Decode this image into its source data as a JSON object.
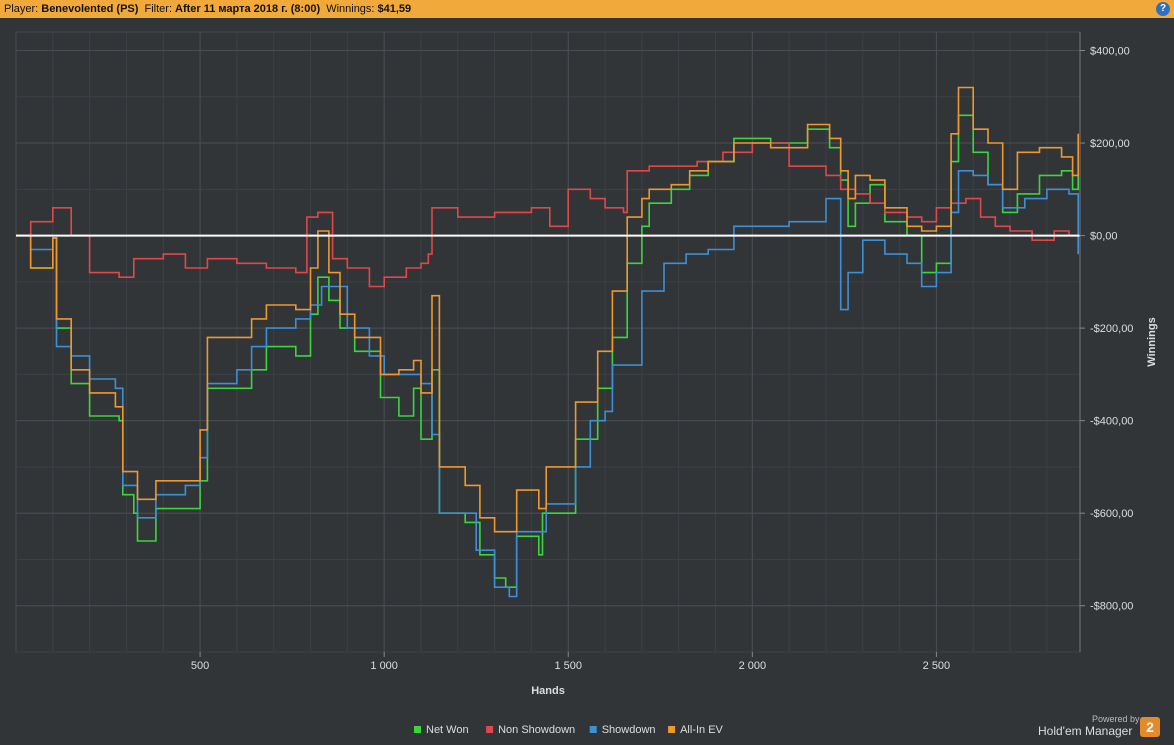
{
  "header": {
    "player_label": "Player:",
    "player_value": "Benevolented (PS)",
    "filter_label": "Filter:",
    "filter_value": "After 11 марта 2018 г. (8:00)",
    "winnings_label": "Winnings:",
    "winnings_value": "$41,59",
    "help_glyph": "?"
  },
  "branding": {
    "caption": "Powered by",
    "name": "Hold'em Manager",
    "badge": "2"
  },
  "colors": {
    "background": "#323538",
    "grid": "#474b4f",
    "zero_line": "#ffffff",
    "header_bar": "#f2a93b",
    "text": "#dddddd"
  },
  "chart_data": {
    "type": "line",
    "xlabel": "Hands",
    "ylabel": "Winnings",
    "xlim": [
      0,
      2890
    ],
    "ylim": [
      -900,
      440
    ],
    "x_ticks": [
      500,
      1000,
      1500,
      2000,
      2500
    ],
    "x_tick_labels": [
      "500",
      "1 000",
      "1 500",
      "2 000",
      "2 500"
    ],
    "y_ticks": [
      400,
      200,
      0,
      -200,
      -400,
      -600,
      -800
    ],
    "y_tick_labels": [
      "$400,00",
      "$200,00",
      "$0,00",
      "-$200,00",
      "-$400,00",
      "-$600,00",
      "-$800,00"
    ],
    "grid": true,
    "legend_position": "bottom",
    "series": [
      {
        "name": "Net Won",
        "color": "#3bd63b",
        "points": [
          [
            0,
            0
          ],
          [
            40,
            -70
          ],
          [
            100,
            -5
          ],
          [
            110,
            -200
          ],
          [
            150,
            -320
          ],
          [
            200,
            -390
          ],
          [
            280,
            -400
          ],
          [
            290,
            -560
          ],
          [
            320,
            -600
          ],
          [
            330,
            -660
          ],
          [
            380,
            -590
          ],
          [
            460,
            -590
          ],
          [
            500,
            -530
          ],
          [
            520,
            -330
          ],
          [
            600,
            -330
          ],
          [
            640,
            -290
          ],
          [
            680,
            -240
          ],
          [
            760,
            -260
          ],
          [
            800,
            -170
          ],
          [
            820,
            -90
          ],
          [
            850,
            -140
          ],
          [
            880,
            -200
          ],
          [
            920,
            -250
          ],
          [
            990,
            -350
          ],
          [
            1040,
            -390
          ],
          [
            1080,
            -330
          ],
          [
            1100,
            -440
          ],
          [
            1130,
            -290
          ],
          [
            1150,
            -600
          ],
          [
            1220,
            -620
          ],
          [
            1260,
            -690
          ],
          [
            1300,
            -740
          ],
          [
            1330,
            -760
          ],
          [
            1360,
            -650
          ],
          [
            1420,
            -690
          ],
          [
            1430,
            -600
          ],
          [
            1520,
            -440
          ],
          [
            1580,
            -330
          ],
          [
            1620,
            -220
          ],
          [
            1660,
            -60
          ],
          [
            1700,
            20
          ],
          [
            1720,
            70
          ],
          [
            1780,
            100
          ],
          [
            1830,
            130
          ],
          [
            1880,
            160
          ],
          [
            1950,
            210
          ],
          [
            2050,
            200
          ],
          [
            2150,
            230
          ],
          [
            2210,
            190
          ],
          [
            2240,
            120
          ],
          [
            2260,
            20
          ],
          [
            2280,
            70
          ],
          [
            2320,
            110
          ],
          [
            2360,
            30
          ],
          [
            2420,
            0
          ],
          [
            2460,
            -80
          ],
          [
            2500,
            -60
          ],
          [
            2540,
            160
          ],
          [
            2560,
            260
          ],
          [
            2600,
            180
          ],
          [
            2640,
            110
          ],
          [
            2680,
            50
          ],
          [
            2720,
            90
          ],
          [
            2780,
            130
          ],
          [
            2840,
            140
          ],
          [
            2870,
            100
          ],
          [
            2885,
            130
          ]
        ]
      },
      {
        "name": "Non Showdown",
        "color": "#e0484a",
        "points": [
          [
            0,
            0
          ],
          [
            40,
            30
          ],
          [
            100,
            60
          ],
          [
            150,
            0
          ],
          [
            200,
            -80
          ],
          [
            280,
            -90
          ],
          [
            320,
            -50
          ],
          [
            400,
            -40
          ],
          [
            460,
            -70
          ],
          [
            520,
            -50
          ],
          [
            600,
            -60
          ],
          [
            680,
            -70
          ],
          [
            760,
            -80
          ],
          [
            790,
            40
          ],
          [
            820,
            50
          ],
          [
            860,
            -50
          ],
          [
            900,
            -70
          ],
          [
            960,
            -110
          ],
          [
            1000,
            -90
          ],
          [
            1060,
            -70
          ],
          [
            1100,
            -60
          ],
          [
            1120,
            -40
          ],
          [
            1130,
            60
          ],
          [
            1200,
            40
          ],
          [
            1300,
            50
          ],
          [
            1400,
            60
          ],
          [
            1450,
            20
          ],
          [
            1500,
            100
          ],
          [
            1560,
            80
          ],
          [
            1600,
            60
          ],
          [
            1650,
            50
          ],
          [
            1660,
            140
          ],
          [
            1720,
            150
          ],
          [
            1800,
            150
          ],
          [
            1850,
            160
          ],
          [
            1920,
            180
          ],
          [
            2000,
            200
          ],
          [
            2100,
            150
          ],
          [
            2200,
            130
          ],
          [
            2240,
            100
          ],
          [
            2280,
            90
          ],
          [
            2320,
            70
          ],
          [
            2360,
            50
          ],
          [
            2420,
            40
          ],
          [
            2460,
            30
          ],
          [
            2500,
            60
          ],
          [
            2540,
            70
          ],
          [
            2580,
            80
          ],
          [
            2620,
            40
          ],
          [
            2660,
            20
          ],
          [
            2700,
            10
          ],
          [
            2760,
            -10
          ],
          [
            2820,
            10
          ],
          [
            2860,
            0
          ],
          [
            2885,
            -40
          ]
        ]
      },
      {
        "name": "Showdown",
        "color": "#3d8fd6",
        "points": [
          [
            0,
            0
          ],
          [
            40,
            -30
          ],
          [
            100,
            -5
          ],
          [
            110,
            -240
          ],
          [
            150,
            -260
          ],
          [
            200,
            -310
          ],
          [
            270,
            -330
          ],
          [
            290,
            -540
          ],
          [
            330,
            -610
          ],
          [
            380,
            -560
          ],
          [
            460,
            -540
          ],
          [
            500,
            -480
          ],
          [
            520,
            -320
          ],
          [
            600,
            -290
          ],
          [
            640,
            -240
          ],
          [
            680,
            -200
          ],
          [
            760,
            -180
          ],
          [
            800,
            -150
          ],
          [
            830,
            -110
          ],
          [
            900,
            -200
          ],
          [
            960,
            -260
          ],
          [
            1000,
            -300
          ],
          [
            1050,
            -300
          ],
          [
            1100,
            -320
          ],
          [
            1130,
            -430
          ],
          [
            1150,
            -600
          ],
          [
            1250,
            -680
          ],
          [
            1300,
            -760
          ],
          [
            1340,
            -780
          ],
          [
            1360,
            -640
          ],
          [
            1420,
            -640
          ],
          [
            1440,
            -580
          ],
          [
            1520,
            -500
          ],
          [
            1560,
            -400
          ],
          [
            1600,
            -380
          ],
          [
            1620,
            -280
          ],
          [
            1700,
            -120
          ],
          [
            1760,
            -60
          ],
          [
            1820,
            -40
          ],
          [
            1880,
            -30
          ],
          [
            1950,
            20
          ],
          [
            2020,
            20
          ],
          [
            2100,
            30
          ],
          [
            2200,
            80
          ],
          [
            2230,
            80
          ],
          [
            2240,
            -160
          ],
          [
            2260,
            -80
          ],
          [
            2300,
            -10
          ],
          [
            2360,
            -40
          ],
          [
            2420,
            -60
          ],
          [
            2460,
            -110
          ],
          [
            2500,
            -80
          ],
          [
            2540,
            50
          ],
          [
            2560,
            140
          ],
          [
            2600,
            130
          ],
          [
            2640,
            110
          ],
          [
            2680,
            60
          ],
          [
            2740,
            80
          ],
          [
            2800,
            100
          ],
          [
            2860,
            90
          ],
          [
            2885,
            -40
          ]
        ]
      },
      {
        "name": "All-In EV",
        "color": "#f0982e",
        "points": [
          [
            0,
            0
          ],
          [
            40,
            -70
          ],
          [
            100,
            -5
          ],
          [
            110,
            -180
          ],
          [
            150,
            -290
          ],
          [
            200,
            -340
          ],
          [
            270,
            -370
          ],
          [
            290,
            -510
          ],
          [
            330,
            -570
          ],
          [
            380,
            -530
          ],
          [
            460,
            -530
          ],
          [
            500,
            -420
          ],
          [
            520,
            -220
          ],
          [
            600,
            -220
          ],
          [
            640,
            -180
          ],
          [
            680,
            -150
          ],
          [
            760,
            -160
          ],
          [
            800,
            -70
          ],
          [
            820,
            10
          ],
          [
            850,
            -80
          ],
          [
            880,
            -170
          ],
          [
            920,
            -220
          ],
          [
            990,
            -300
          ],
          [
            1040,
            -290
          ],
          [
            1080,
            -270
          ],
          [
            1100,
            -340
          ],
          [
            1130,
            -130
          ],
          [
            1150,
            -500
          ],
          [
            1220,
            -540
          ],
          [
            1260,
            -610
          ],
          [
            1300,
            -640
          ],
          [
            1330,
            -640
          ],
          [
            1360,
            -550
          ],
          [
            1420,
            -590
          ],
          [
            1440,
            -500
          ],
          [
            1520,
            -360
          ],
          [
            1580,
            -250
          ],
          [
            1620,
            -120
          ],
          [
            1660,
            40
          ],
          [
            1700,
            80
          ],
          [
            1720,
            100
          ],
          [
            1780,
            110
          ],
          [
            1830,
            140
          ],
          [
            1880,
            160
          ],
          [
            1950,
            200
          ],
          [
            2050,
            190
          ],
          [
            2150,
            240
          ],
          [
            2210,
            210
          ],
          [
            2240,
            140
          ],
          [
            2260,
            80
          ],
          [
            2280,
            130
          ],
          [
            2320,
            120
          ],
          [
            2360,
            60
          ],
          [
            2420,
            20
          ],
          [
            2460,
            10
          ],
          [
            2500,
            20
          ],
          [
            2540,
            220
          ],
          [
            2560,
            320
          ],
          [
            2600,
            230
          ],
          [
            2640,
            200
          ],
          [
            2680,
            100
          ],
          [
            2720,
            180
          ],
          [
            2780,
            190
          ],
          [
            2840,
            170
          ],
          [
            2870,
            130
          ],
          [
            2885,
            220
          ]
        ]
      }
    ]
  }
}
